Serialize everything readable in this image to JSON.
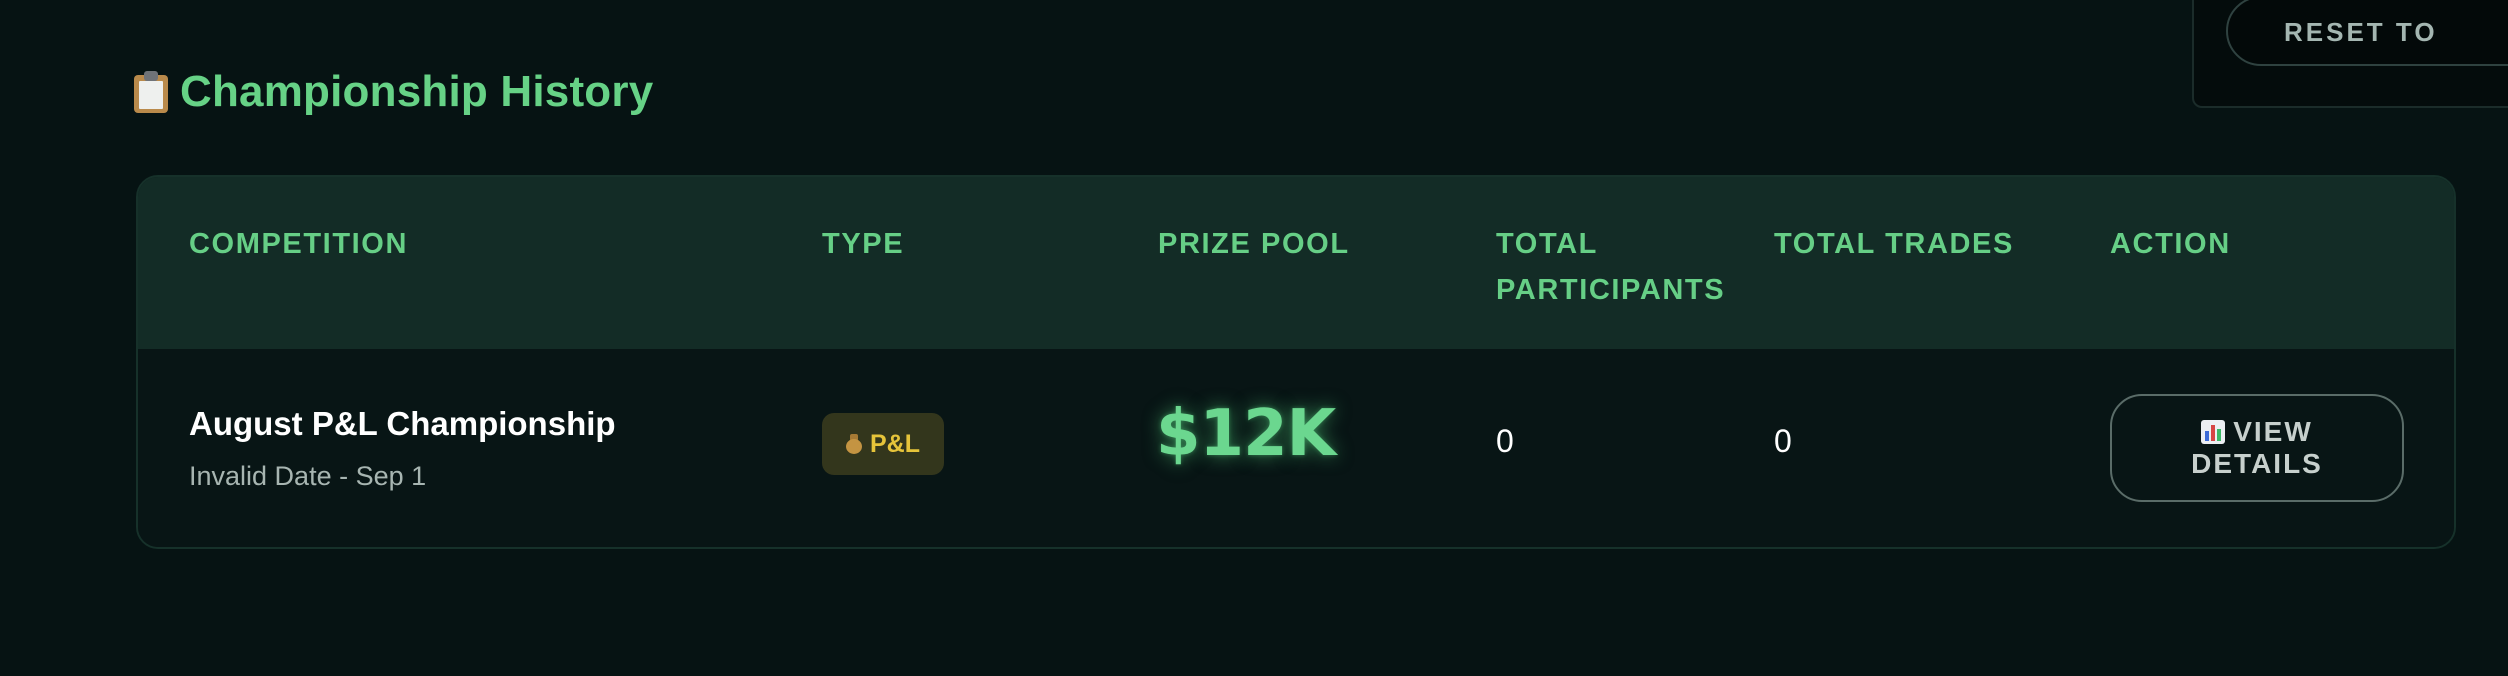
{
  "top_panel": {
    "reset_label": "RESET TO"
  },
  "section": {
    "icon": "clipboard-icon",
    "title": "Championship History"
  },
  "table": {
    "headers": {
      "competition": "COMPETITION",
      "type": "TYPE",
      "prize_pool": "PRIZE POOL",
      "total_participants_line1": "TOTAL",
      "total_participants_line2": "PARTICIPANTS",
      "total_trades": "TOTAL TRADES",
      "action": "ACTION"
    },
    "rows": [
      {
        "name": "August P&L Championship",
        "dates": "Invalid Date - Sep 1",
        "type_icon": "moneybag-icon",
        "type_label": "P&L",
        "prize_pool": "$12K",
        "total_participants": "0",
        "total_trades": "0",
        "action_icon": "bar-chart-icon",
        "action_line1": "VIEW",
        "action_line2": "DETAILS"
      }
    ]
  },
  "colors": {
    "background": "#061313",
    "accent_green": "#66d286",
    "header_bg": "#132c26",
    "badge_bg": "#33361c",
    "badge_text": "#e6c43a"
  }
}
